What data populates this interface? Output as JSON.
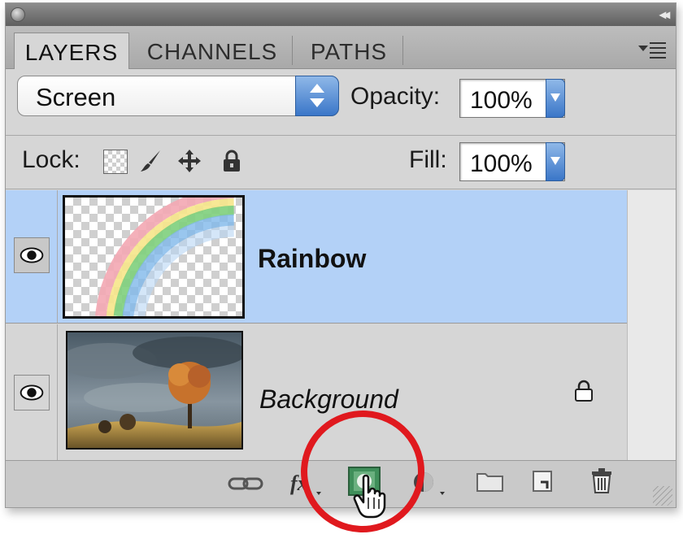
{
  "panel": {
    "tabs": [
      {
        "label": "LAYERS",
        "active": true
      },
      {
        "label": "CHANNELS",
        "active": false
      },
      {
        "label": "PATHS",
        "active": false
      }
    ]
  },
  "blend_mode": {
    "value": "Screen"
  },
  "opacity": {
    "label": "Opacity:",
    "value": "100%"
  },
  "lock": {
    "label": "Lock:",
    "icons": [
      "lock-transparent-pixels-icon",
      "lock-image-pixels-icon",
      "lock-position-icon",
      "lock-all-icon"
    ]
  },
  "fill": {
    "label": "Fill:",
    "value": "100%"
  },
  "layers": [
    {
      "name": "Rainbow",
      "selected": true,
      "visible": true,
      "style": "bold"
    },
    {
      "name": "Background",
      "selected": false,
      "visible": true,
      "style": "italic",
      "locked": true
    }
  ],
  "bottom_icons": [
    "link-layers-icon",
    "layer-style-icon",
    "add-layer-mask-icon",
    "adjustment-layer-icon",
    "new-group-icon",
    "new-layer-icon",
    "delete-layer-icon"
  ],
  "colors": {
    "selection": "#b3d1f7",
    "accent": "#3a76c8",
    "highlight_circle": "#e0191e"
  }
}
